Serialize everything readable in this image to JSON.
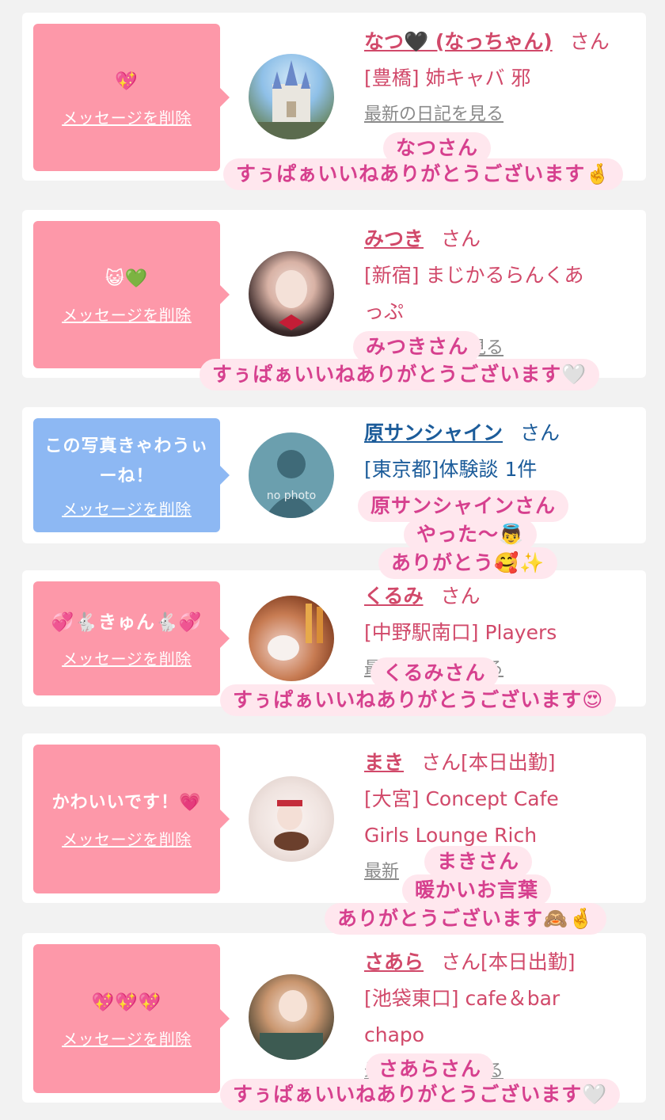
{
  "delete_label": "メッセージを削除",
  "honorific": "さん",
  "cards": [
    {
      "message": "💖",
      "name": "なつ🖤 (なっちゃん)",
      "honorific": "さん",
      "extra": "",
      "area_line1": "[豊橋] 姉キャバ 邪",
      "area_line2": "",
      "latest": "最新の日記を見る",
      "caption": [
        "なつさん",
        "すぅぱぁいいねありがとうございます🤞"
      ]
    },
    {
      "message": "😺💚",
      "name": "みつき",
      "honorific": "さん",
      "extra": "",
      "area_line1": "[新宿] まじかるらんくあ",
      "area_line2": "っぷ",
      "latest": "最新の日記を見る",
      "caption": [
        "みつきさん",
        "すぅぱぁいいねありがとうございます🤍"
      ]
    },
    {
      "message": "この写真きゃわうぃーね！",
      "name": "原サンシャイン",
      "honorific": "さん",
      "extra": "",
      "area_line1": "[東京都]体験談 1件",
      "area_line2": "",
      "latest": "",
      "avatar_text": "no photo",
      "caption": [
        "原サンシャインさん",
        "やった〜👼",
        "ありがとう🥰✨"
      ]
    },
    {
      "message": "💞🐇きゅん🐇💞",
      "name": "くるみ",
      "honorific": "さん",
      "extra": "",
      "area_line1": "[中野駅南口] Players",
      "area_line2": "",
      "latest": "最新の日記を見る",
      "caption": [
        "くるみさん",
        "すぅぱぁいいねありがとうございます😍"
      ]
    },
    {
      "message": "かわいいです！💗",
      "name": "まき",
      "honorific": "さん",
      "extra": "[本日出勤]",
      "area_line1": "[大宮] Concept Cafe",
      "area_line2": "Girls Lounge Rich",
      "latest": "最新",
      "caption": [
        "まきさん",
        "暖かいお言葉",
        "ありがとうございます🙈🤞"
      ]
    },
    {
      "message": "💖💖💖",
      "name": "さあら",
      "honorific": "さん",
      "extra": "[本日出勤]",
      "area_line1": "[池袋東口] cafe＆bar",
      "area_line2": "chapo",
      "latest": "最新の日記を見る",
      "caption": [
        "さあらさん",
        "すぅぱぁいいねありがとうございます🤍"
      ]
    }
  ],
  "colors": {
    "bubble_pink": "#fd98a9",
    "bubble_blue": "#8db8f3",
    "name_pink": "#d1496a",
    "name_blue": "#1c5c9a",
    "caption_text": "#d6408e"
  }
}
